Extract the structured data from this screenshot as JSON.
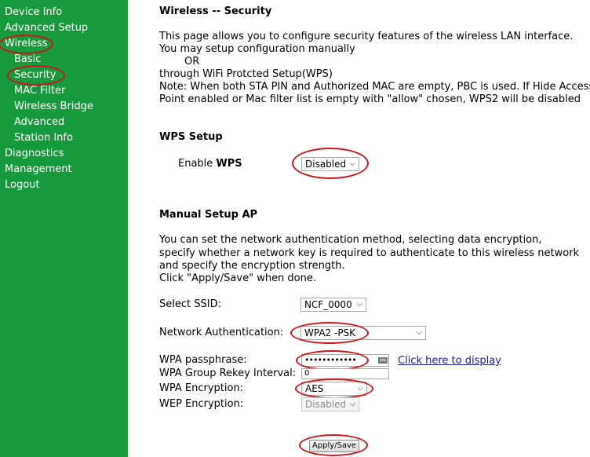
{
  "sidebar": {
    "items": [
      {
        "label": "Device Info"
      },
      {
        "label": "Advanced Setup"
      },
      {
        "label": "Wireless"
      },
      {
        "label": "Basic"
      },
      {
        "label": "Security"
      },
      {
        "label": "MAC Filter"
      },
      {
        "label": "Wireless Bridge"
      },
      {
        "label": "Advanced"
      },
      {
        "label": "Station Info"
      },
      {
        "label": "Diagnostics"
      },
      {
        "label": "Management"
      },
      {
        "label": "Logout"
      }
    ]
  },
  "page": {
    "title": "Wireless -- Security",
    "intro": [
      "This page allows you to configure security features of the wireless LAN interface.",
      "You may setup configuration manually",
      "OR",
      "through WiFi Protcted Setup(WPS)",
      "Note: When both STA PIN and Authorized MAC are empty, PBC is used. If Hide Access",
      "Point enabled or Mac filter list is empty with \"allow\" chosen, WPS2 will be disabled"
    ]
  },
  "wps": {
    "heading": "WPS Setup",
    "enable_label_prefix": "Enable ",
    "enable_label_bold": "WPS",
    "enable_value": "Disabled"
  },
  "manual": {
    "heading": "Manual Setup AP",
    "description": [
      "You can set the network authentication method, selecting data encryption,",
      "specify whether a network key is required to authenticate to this wireless network",
      "and specify the encryption strength.",
      "Click \"Apply/Save\" when done."
    ],
    "ssid_label": "Select SSID:",
    "ssid_value": "NCF_0000",
    "auth_label": "Network Authentication:",
    "auth_value": "WPA2 -PSK",
    "passphrase_label": "WPA passphrase:",
    "passphrase_value": "••••••••••••",
    "display_link": "Click here to display",
    "rekey_label": "WPA Group Rekey Interval:",
    "rekey_value": "0",
    "encryption_label": "WPA Encryption:",
    "encryption_value": "AES",
    "wep_label": "WEP Encryption:",
    "wep_value": "Disabled",
    "apply_label": "Apply/Save"
  },
  "colors": {
    "sidebar": "#169a3b",
    "highlight_ring": "#d0141b",
    "link": "#1a1aa6"
  }
}
